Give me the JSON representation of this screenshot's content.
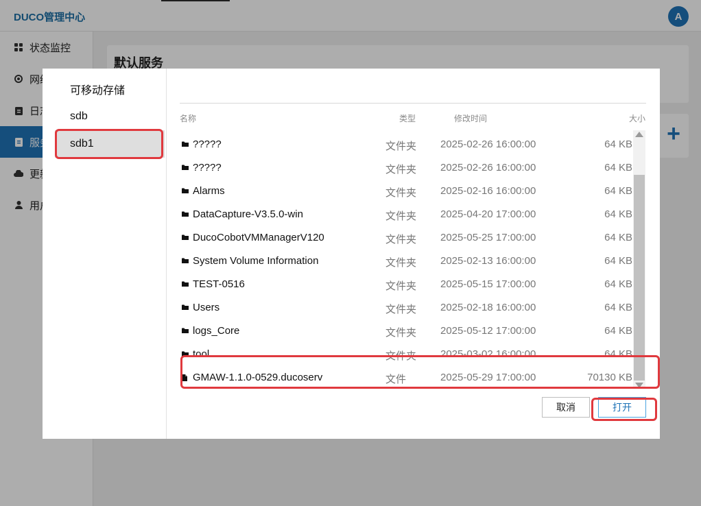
{
  "app": {
    "title": "DUCO管理中心",
    "avatar_letter": "A",
    "nav": [
      {
        "label": "状态监控",
        "icon": "grid-icon"
      },
      {
        "label": "网络",
        "icon": "circle-dot-icon"
      },
      {
        "label": "日志",
        "icon": "clipboard-icon"
      },
      {
        "label": "服务",
        "icon": "document-icon"
      },
      {
        "label": "更新",
        "icon": "cloud-icon"
      },
      {
        "label": "用户",
        "icon": "user-icon"
      }
    ],
    "active_nav": 3,
    "page_title": "默认服务"
  },
  "dialog": {
    "drives": [
      {
        "label": "可移动存储"
      },
      {
        "label": "sdb"
      },
      {
        "label": "sdb1"
      }
    ],
    "selected_drive": 2,
    "columns": {
      "name": "名称",
      "type": "类型",
      "modified": "修改时间",
      "size": "大小"
    },
    "files": [
      {
        "name": "?????",
        "type": "文件夹",
        "modified": "2025-02-26 16:00:00",
        "size": "64 KB",
        "kind": "folder"
      },
      {
        "name": "?????",
        "type": "文件夹",
        "modified": "2025-02-26 16:00:00",
        "size": "64 KB",
        "kind": "folder"
      },
      {
        "name": "Alarms",
        "type": "文件夹",
        "modified": "2025-02-16 16:00:00",
        "size": "64 KB",
        "kind": "folder"
      },
      {
        "name": "DataCapture-V3.5.0-win",
        "type": "文件夹",
        "modified": "2025-04-20 17:00:00",
        "size": "64 KB",
        "kind": "folder"
      },
      {
        "name": "DucoCobotVMManagerV120",
        "type": "文件夹",
        "modified": "2025-05-25 17:00:00",
        "size": "64 KB",
        "kind": "folder"
      },
      {
        "name": "System Volume Information",
        "type": "文件夹",
        "modified": "2025-02-13 16:00:00",
        "size": "64 KB",
        "kind": "folder"
      },
      {
        "name": "TEST-0516",
        "type": "文件夹",
        "modified": "2025-05-15 17:00:00",
        "size": "64 KB",
        "kind": "folder"
      },
      {
        "name": "Users",
        "type": "文件夹",
        "modified": "2025-02-18 16:00:00",
        "size": "64 KB",
        "kind": "folder"
      },
      {
        "name": "logs_Core",
        "type": "文件夹",
        "modified": "2025-05-12 17:00:00",
        "size": "64 KB",
        "kind": "folder"
      },
      {
        "name": "tool",
        "type": "文件夹",
        "modified": "2025-03-02 16:00:00",
        "size": "64 KB",
        "kind": "folder"
      },
      {
        "name": "GMAW-1.1.0-0529.ducoserv",
        "type": "文件",
        "modified": "2025-05-29 17:00:00",
        "size": "70130 KB",
        "kind": "file"
      }
    ],
    "cancel_label": "取消",
    "open_label": "打开"
  },
  "colors": {
    "accent": "#1f73b7",
    "highlight": "#e0393e"
  }
}
